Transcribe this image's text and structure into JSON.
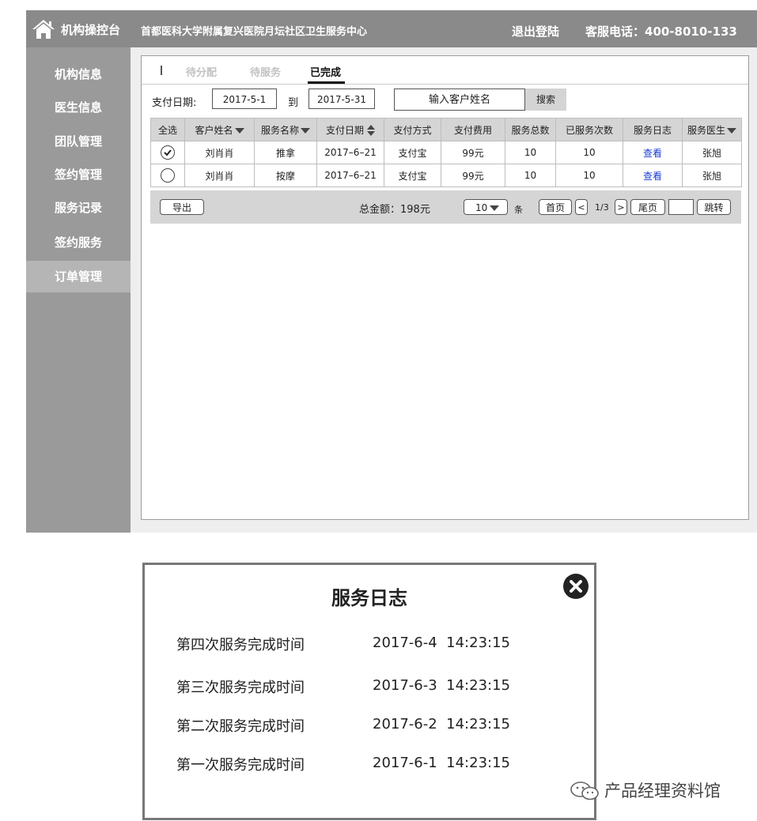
{
  "header": {
    "home_icon": "home-icon",
    "app_title": "机构操控台",
    "org_name": "首都医科大学附属复兴医院月坛社区卫生服务中心",
    "logout": "退出登陆",
    "phone": "客服电话：400-8010-133"
  },
  "sidebar": {
    "items": [
      {
        "label": "机构信息"
      },
      {
        "label": "医生信息"
      },
      {
        "label": "团队管理"
      },
      {
        "label": "签约管理"
      },
      {
        "label": "服务记录"
      },
      {
        "label": "签约服务"
      },
      {
        "label": "订单管理",
        "active": true
      }
    ]
  },
  "tabs": [
    {
      "label": "待分配"
    },
    {
      "label": "待服务"
    },
    {
      "label": "已完成",
      "active": true
    }
  ],
  "filter": {
    "date_label": "支付日期:",
    "date_from": "2017-5-1",
    "to_label": "到",
    "date_to": "2017-5-31",
    "name_placeholder": "输入客户姓名",
    "search": "搜索"
  },
  "table": {
    "headers": [
      "全选",
      "客户姓名",
      "服务名称",
      "支付日期",
      "支付方式",
      "支付费用",
      "服务总数",
      "已服务次数",
      "服务日志",
      "服务医生"
    ],
    "rows": [
      {
        "checked": true,
        "cells": [
          "刘肖肖",
          "推拿",
          "2017–6–21",
          "支付宝",
          "99元",
          "10",
          "10",
          "查看",
          "张旭"
        ]
      },
      {
        "checked": false,
        "cells": [
          "刘肖肖",
          "按摩",
          "2017–6–21",
          "支付宝",
          "99元",
          "10",
          "10",
          "查看",
          "张旭"
        ]
      }
    ]
  },
  "footer": {
    "export": "导出",
    "total": "总金额：198元",
    "page_size": "10",
    "unit": "条",
    "first": "首页",
    "prev": "<",
    "page_info": "1/3",
    "next": ">",
    "last": "尾页",
    "jump": "跳转"
  },
  "modal": {
    "title": "服务日志",
    "close_icon": "close-icon",
    "entries": [
      {
        "label": "第四次服务完成时间",
        "time": "2017-6-4  14:23:15"
      },
      {
        "label": "第三次服务完成时间",
        "time": "2017-6-3  14:23:15"
      },
      {
        "label": "第二次服务完成时间",
        "time": "2017-6-2  14:23:15"
      },
      {
        "label": "第一次服务完成时间",
        "time": "2017-6-1  14:23:15"
      }
    ]
  },
  "watermark": {
    "icon": "wechat-icon",
    "text": "产品经理资料馆"
  }
}
